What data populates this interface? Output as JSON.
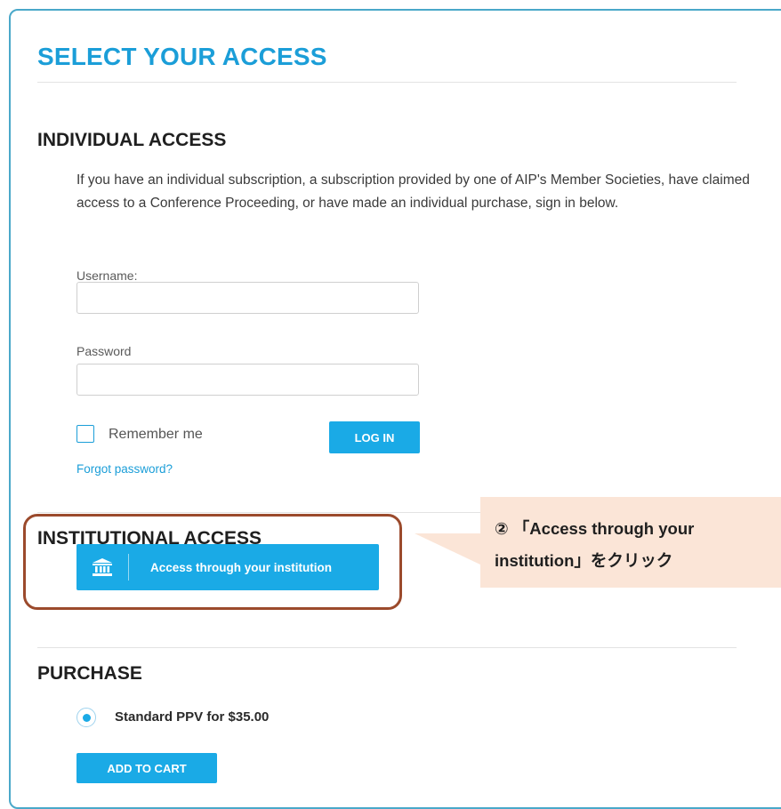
{
  "page": {
    "title": "SELECT YOUR ACCESS"
  },
  "individual": {
    "heading": "INDIVIDUAL ACCESS",
    "description": "If you have an individual subscription, a subscription provided by one of AIP's Member Societies, have claimed access to a Conference Proceeding, or have made an individual purchase, sign in below.",
    "username_label": "Username:",
    "username_value": "",
    "password_label": "Password",
    "password_value": "",
    "remember_label": "Remember me",
    "remember_checked": false,
    "login_label": "LOG IN",
    "forgot_label": "Forgot password?"
  },
  "institutional": {
    "heading": "INSTITUTIONAL ACCESS",
    "button_label": "Access through your institution",
    "button_icon": "institution-icon"
  },
  "callout": {
    "line1": "② 「Access through your",
    "line2": "institution」をクリック"
  },
  "purchase": {
    "heading": "PURCHASE",
    "option_label": "Standard PPV for $35.00",
    "option_selected": true,
    "add_to_cart_label": "ADD TO CART"
  },
  "colors": {
    "accent": "#1aaae6",
    "title": "#1b9ed8",
    "highlight_border": "#9b4a2c",
    "callout_bg": "#fbe5d7"
  }
}
